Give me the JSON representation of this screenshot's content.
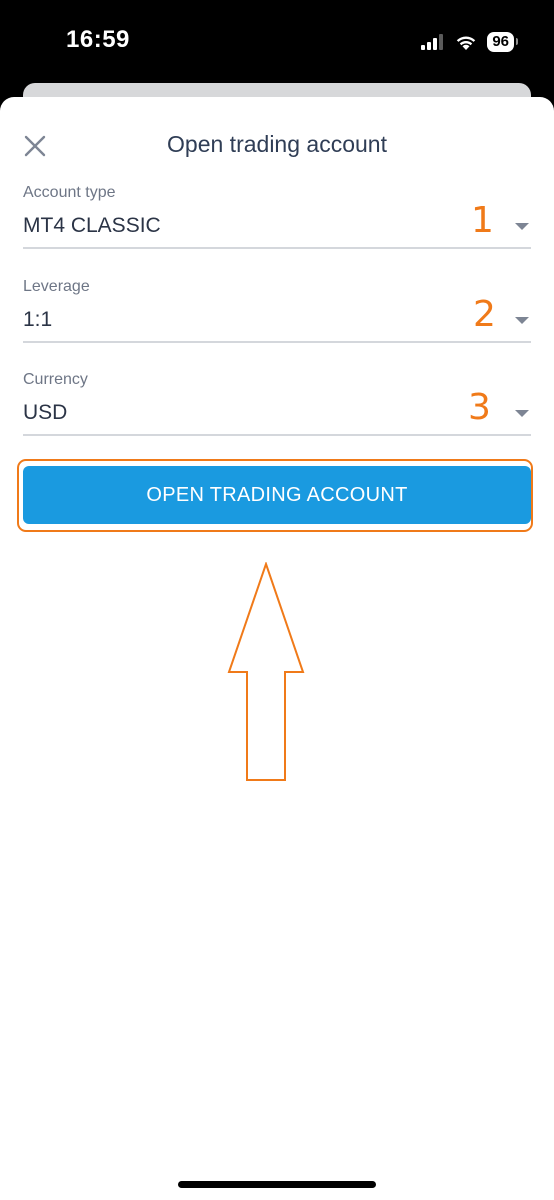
{
  "status_bar": {
    "time": "16:59",
    "battery": "96"
  },
  "header": {
    "title": "Open trading account"
  },
  "fields": [
    {
      "label": "Account type",
      "value": "MT4 CLASSIC",
      "annotation": "1"
    },
    {
      "label": "Leverage",
      "value": "1:1",
      "annotation": "2"
    },
    {
      "label": "Currency",
      "value": "USD",
      "annotation": "3"
    }
  ],
  "submit": {
    "label": "OPEN TRADING ACCOUNT"
  },
  "colors": {
    "accent": "#1a9ae0",
    "annotation": "#f07a19",
    "title": "#2f3d55"
  }
}
